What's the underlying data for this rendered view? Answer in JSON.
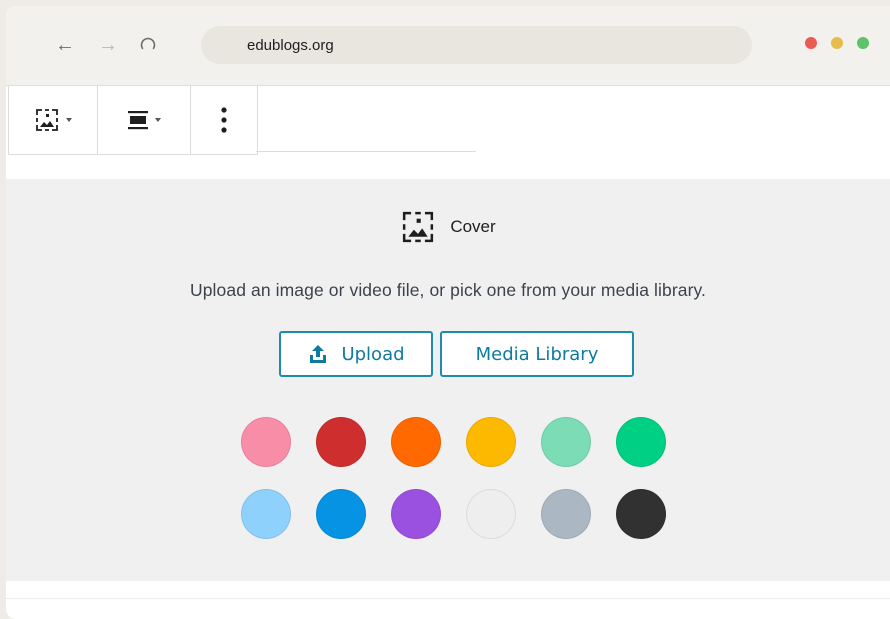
{
  "browser": {
    "url": "edublogs.org",
    "window_dots": [
      {
        "name": "close",
        "color": "#ec5a55"
      },
      {
        "name": "minimize",
        "color": "#e6bd4a"
      },
      {
        "name": "maximize",
        "color": "#5fc26a"
      }
    ]
  },
  "toolbar": {
    "block_type_icon": "cover-block-icon",
    "align_icon": "align-full-icon",
    "more_icon": "vertical-ellipsis-icon"
  },
  "cover": {
    "title": "Cover",
    "instructions": "Upload an image or video file, or pick one from your media library.",
    "upload_label": "Upload",
    "media_library_label": "Media Library",
    "swatches": [
      {
        "color": "#f78da7"
      },
      {
        "color": "#cf2e2e"
      },
      {
        "color": "#ff6900"
      },
      {
        "color": "#fcb900"
      },
      {
        "color": "#7bdcb5"
      },
      {
        "color": "#00d084"
      },
      {
        "color": "#8ed1fc"
      },
      {
        "color": "#0693e3"
      },
      {
        "color": "#9b51e0"
      },
      {
        "color": "#eeeeee"
      },
      {
        "color": "#abb8c3"
      },
      {
        "color": "#313131"
      }
    ]
  }
}
